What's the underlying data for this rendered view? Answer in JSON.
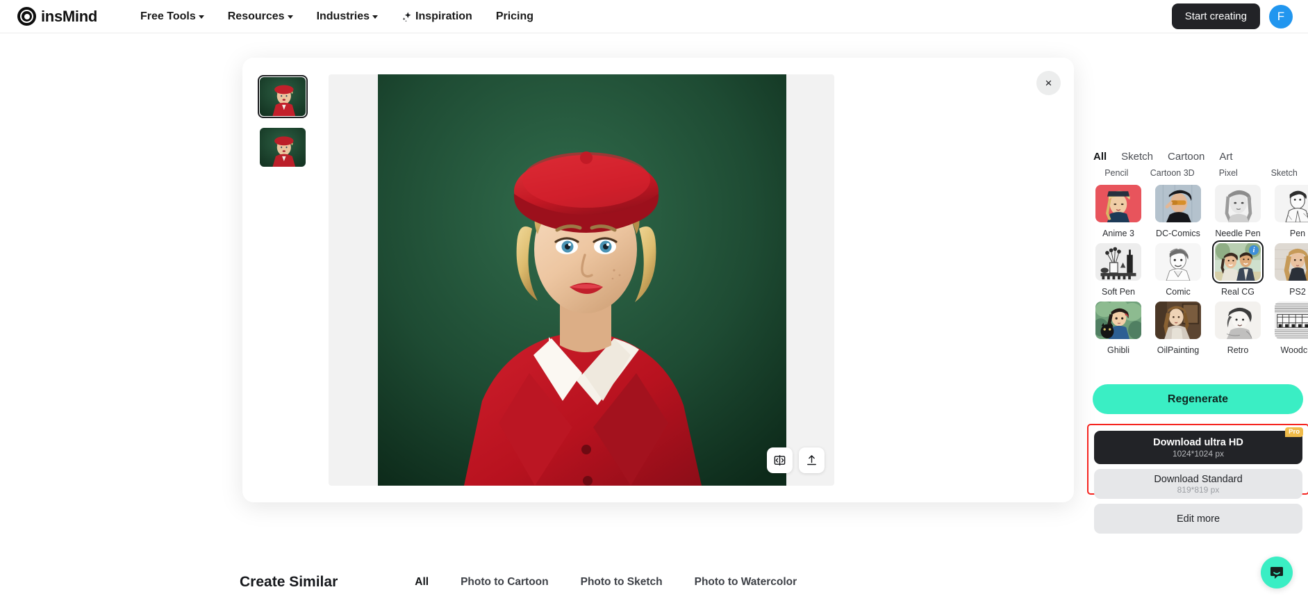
{
  "header": {
    "brand": "insMind",
    "nav": [
      {
        "label": "Free Tools",
        "caret": true,
        "icon": null
      },
      {
        "label": "Resources",
        "caret": true,
        "icon": null
      },
      {
        "label": "Industries",
        "caret": true,
        "icon": null
      },
      {
        "label": "Inspiration",
        "caret": false,
        "icon": "sparkle-icon"
      },
      {
        "label": "Pricing",
        "caret": false,
        "icon": null
      }
    ],
    "start_creating": "Start creating",
    "avatar_initial": "F",
    "avatar_color": "#2196ef"
  },
  "modal": {
    "close_label": "×",
    "thumbnails": [
      {
        "name": "result-thumbnail-1",
        "selected": true
      },
      {
        "name": "result-thumbnail-2",
        "selected": false
      }
    ],
    "canvas_tools": [
      {
        "name": "compare-split-icon"
      },
      {
        "name": "share-upload-icon"
      }
    ]
  },
  "panel": {
    "tabs": [
      {
        "label": "All",
        "active": true
      },
      {
        "label": "Sketch",
        "active": false
      },
      {
        "label": "Cartoon",
        "active": false
      },
      {
        "label": "Art",
        "active": false
      }
    ],
    "group_labels": [
      "Pencil",
      "Cartoon 3D",
      "Pixel",
      "Sketch"
    ],
    "styles": [
      [
        {
          "label": "Anime 3",
          "selected": false,
          "badge": null
        },
        {
          "label": "DC-Comics",
          "selected": false,
          "badge": null
        },
        {
          "label": "Needle Pen",
          "selected": false,
          "badge": null
        },
        {
          "label": "Pen",
          "selected": false,
          "badge": null
        }
      ],
      [
        {
          "label": "Soft Pen",
          "selected": false,
          "badge": null
        },
        {
          "label": "Comic",
          "selected": false,
          "badge": null
        },
        {
          "label": "Real CG",
          "selected": true,
          "badge": "i"
        },
        {
          "label": "PS2",
          "selected": false,
          "badge": null
        }
      ],
      [
        {
          "label": "Ghibli",
          "selected": false,
          "badge": null
        },
        {
          "label": "OilPainting",
          "selected": false,
          "badge": null
        },
        {
          "label": "Retro",
          "selected": false,
          "badge": null
        },
        {
          "label": "Woodcut",
          "selected": false,
          "badge": null
        }
      ]
    ],
    "regenerate": "Regenerate",
    "regenerate_color": "#3aeec4",
    "download_ultra": {
      "title": "Download ultra HD",
      "subtitle": "1024*1024 px",
      "badge": "Pro"
    },
    "download_standard": {
      "title": "Download Standard",
      "subtitle": "819*819 px"
    },
    "edit_more": "Edit more",
    "highlight_color": "#f5241f"
  },
  "bottom": {
    "title": "Create Similar",
    "tabs": [
      {
        "label": "All",
        "active": true
      },
      {
        "label": "Photo to Cartoon",
        "active": false
      },
      {
        "label": "Photo to Sketch",
        "active": false
      },
      {
        "label": "Photo to Watercolor",
        "active": false
      }
    ]
  },
  "chat": {
    "name": "chat-support-button",
    "color": "#3aeec4"
  }
}
